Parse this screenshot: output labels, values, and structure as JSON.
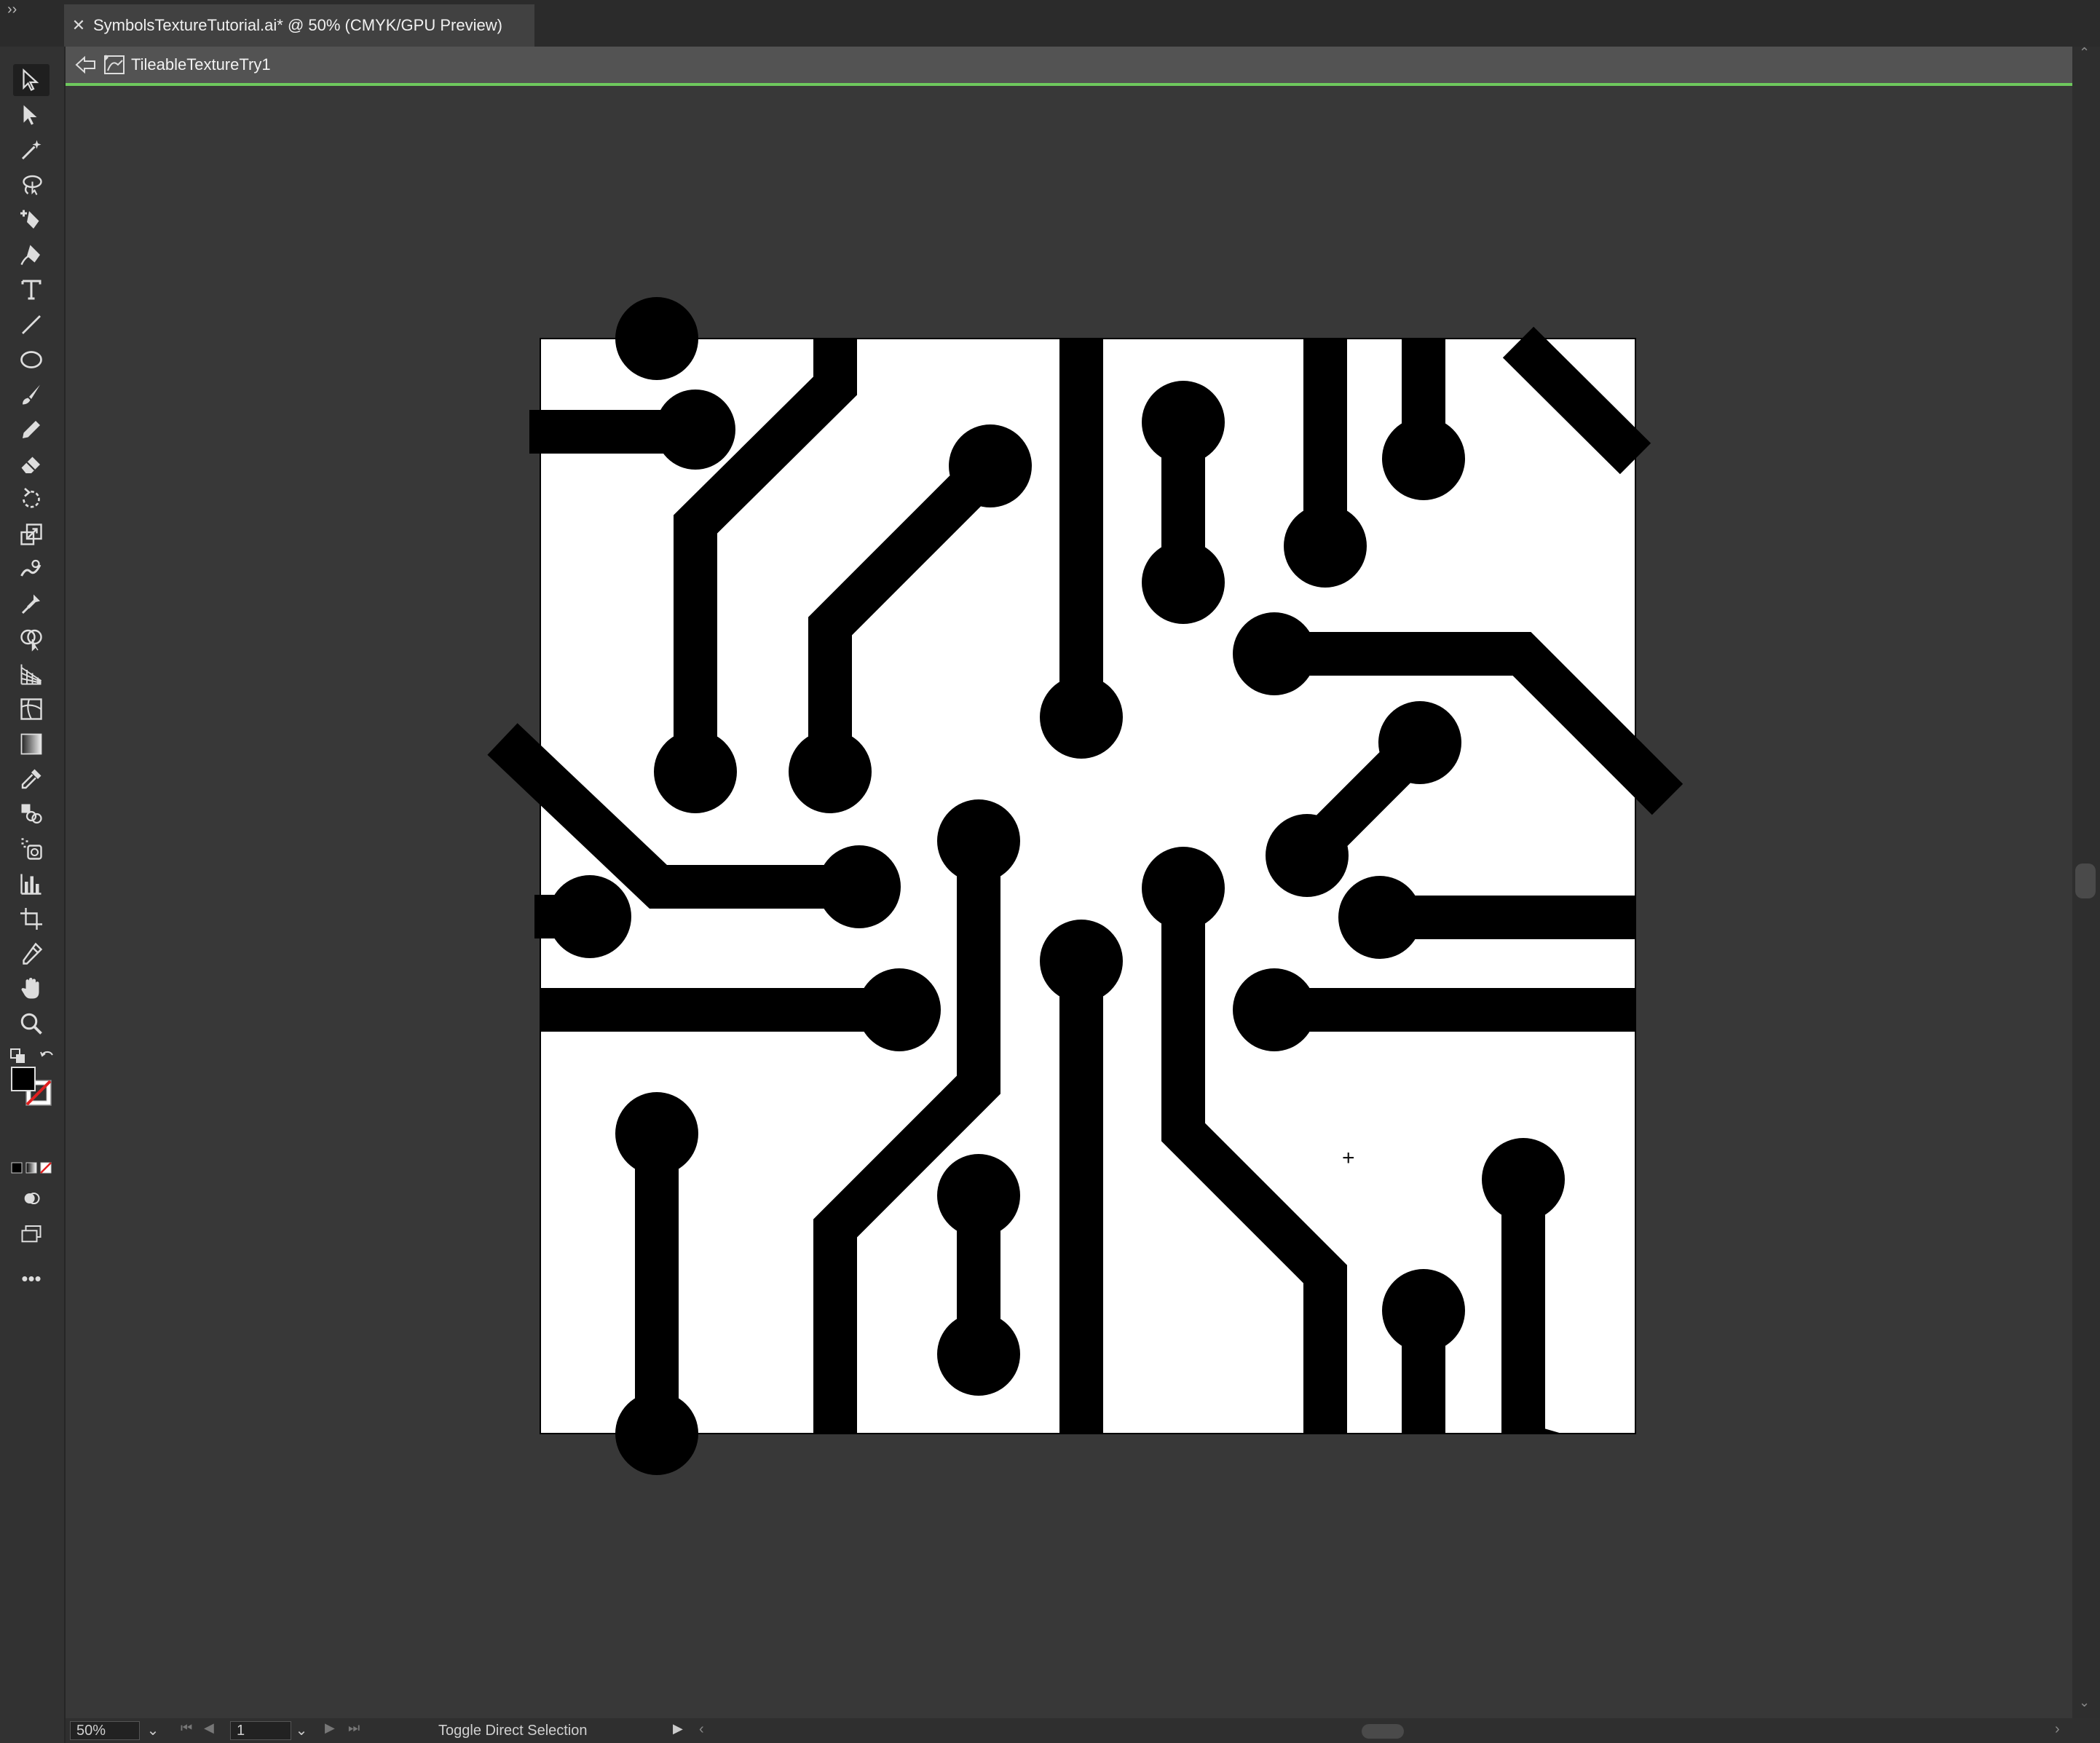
{
  "document_tab": {
    "close_label": "✕",
    "title": "SymbolsTextureTutorial.ai* @ 50% (CMYK/GPU Preview)"
  },
  "panel_toggle": "››",
  "isolation": {
    "symbol_name": "TileableTextureTry1",
    "accent_color": "#6ec85d"
  },
  "tools": [
    "selection-tool",
    "direct-selection-tool",
    "magic-wand-tool",
    "lasso-tool",
    "curvature-tool",
    "pen-tool",
    "type-tool",
    "line-segment-tool",
    "ellipse-tool",
    "paintbrush-tool",
    "pencil-tool",
    "eraser-tool",
    "rotate-tool",
    "scale-tool",
    "warp-tool",
    "puppet-warp-tool",
    "shape-builder-tool",
    "perspective-grid-tool",
    "mesh-tool",
    "gradient-tool",
    "eyedropper-tool",
    "blend-tool",
    "symbol-sprayer-tool",
    "column-graph-tool",
    "artboard-tool",
    "slice-tool",
    "hand-tool",
    "zoom-tool"
  ],
  "fill_stroke": {
    "fill_color": "#ffffff",
    "stroke_color": "#000000"
  },
  "more_tools_label": "•••",
  "status_bar": {
    "zoom": "50%",
    "page": "1",
    "status_text": "Toggle Direct Selection",
    "dropdown_glyph": "⌄"
  },
  "canvas": {
    "artboard_color": "#ffffff",
    "art_color": "#000000",
    "pasteboard_color": "#383838"
  }
}
